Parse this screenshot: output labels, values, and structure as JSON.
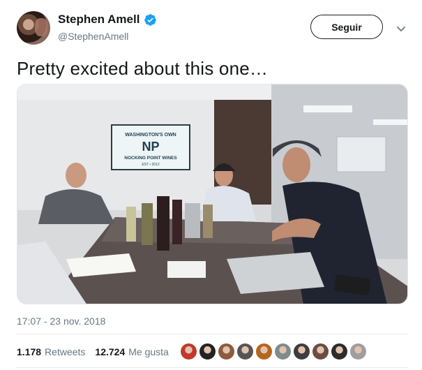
{
  "author": {
    "name": "Stephen Amell",
    "handle": "@StephenAmell",
    "verified_icon": "verified-badge-icon",
    "accent": "#1da1f2"
  },
  "actions": {
    "follow_label": "Seguir",
    "menu_icon": "chevron-down-icon"
  },
  "tweet": {
    "text": "Pretty excited about this one…",
    "timestamp": "17:07 - 23 nov. 2018"
  },
  "photo": {
    "sign_lines": [
      "WASHINGTON'S OWN",
      "NP",
      "NOCKING POINT WINES",
      "EST • 2012"
    ]
  },
  "stats": {
    "retweets_count": "1.178",
    "retweets_label": "Retweets",
    "likes_count": "12.724",
    "likes_label": "Me gusta"
  },
  "likers": [
    {
      "color": "#c0392b"
    },
    {
      "color": "#222222"
    },
    {
      "color": "#8e5b3c"
    },
    {
      "color": "#555555"
    },
    {
      "color": "#b5651d"
    },
    {
      "color": "#7f8c8d"
    },
    {
      "color": "#3d3d3d"
    },
    {
      "color": "#6d4c41"
    },
    {
      "color": "#2c2c2c"
    },
    {
      "color": "#9e9e9e"
    }
  ]
}
